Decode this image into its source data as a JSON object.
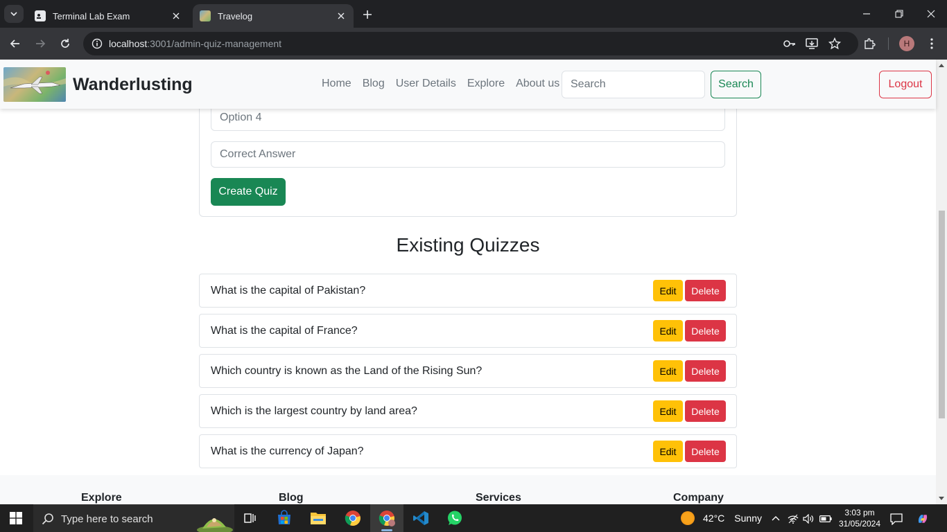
{
  "browser": {
    "tabs": [
      {
        "title": "Terminal Lab Exam",
        "active": false
      },
      {
        "title": "Travelog",
        "active": true
      }
    ],
    "url_host": "localhost",
    "url_rest": ":3001/admin-quiz-management",
    "profile_initial": "H"
  },
  "navbar": {
    "brand": "Wanderlusting",
    "links": [
      "Home",
      "Blog",
      "User Details",
      "Explore",
      "About us"
    ],
    "search_placeholder": "Search",
    "search_button": "Search",
    "logout_button": "Logout"
  },
  "form": {
    "option4_placeholder": "Option 4",
    "correct_answer_placeholder": "Correct Answer",
    "create_button": "Create Quiz"
  },
  "quizzes": {
    "title": "Existing Quizzes",
    "edit_label": "Edit",
    "delete_label": "Delete",
    "items": [
      "What is the capital of Pakistan?",
      "What is the capital of France?",
      "Which country is known as the Land of the Rising Sun?",
      "Which is the largest country by land area?",
      "What is the currency of Japan?"
    ]
  },
  "footer": {
    "columns": [
      "Explore",
      "Blog",
      "Services",
      "Company"
    ]
  },
  "taskbar": {
    "search_placeholder": "Type here to search",
    "weather_temp": "42°C",
    "weather_text": "Sunny",
    "time": "3:03 pm",
    "date": "31/05/2024"
  },
  "colors": {
    "success": "#198754",
    "danger": "#dc3545",
    "warning": "#ffc107",
    "navbar_bg": "#f8f9fa"
  }
}
